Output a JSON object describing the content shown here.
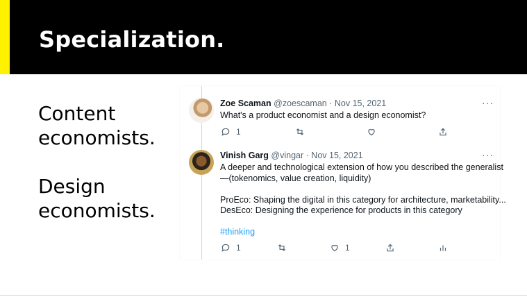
{
  "slide": {
    "title": "Specialization.",
    "accent_color": "#FFF200",
    "bullets": [
      {
        "line1": "Content",
        "line2": "economists."
      },
      {
        "line1": "Design",
        "line2": "economists."
      }
    ]
  },
  "tweets": [
    {
      "name": "Zoe Scaman",
      "handle": "@zoescaman",
      "date": "· Nov 15, 2021",
      "more": "···",
      "text": [
        "What's a product economist and a design economist?"
      ],
      "actions": {
        "reply_count": "1",
        "retweet_count": "",
        "like_count": ""
      },
      "avatar_icon": "profile-photo"
    },
    {
      "name": "Vinish Garg",
      "handle": "@vingar",
      "date": "· Nov 15, 2021",
      "more": "···",
      "text": [
        "A deeper and technological extension of how you described the generalist",
        "—(tokenomics, value creation, liquidity)",
        "",
        "ProEco: Shaping the digital in this category for architecture, marketability...",
        "DesEco: Designing the experience for products in this category"
      ],
      "hashtag": "#thinking",
      "actions": {
        "reply_count": "1",
        "retweet_count": "",
        "like_count": "1"
      },
      "avatar_icon": "profile-photo"
    }
  ]
}
